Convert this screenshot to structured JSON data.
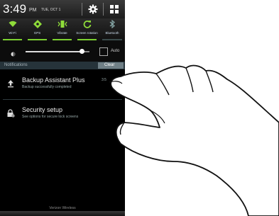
{
  "status_bar": {
    "time": "3:49",
    "ampm": "PM",
    "date": "TUE, OCT 1",
    "settings_icon": "gear-icon",
    "grid_icon": "grid-icon"
  },
  "quick_toggles": [
    {
      "label": "Wi-Fi",
      "icon": "wifi-icon",
      "state": "on"
    },
    {
      "label": "GPS",
      "icon": "gps-icon",
      "state": "on"
    },
    {
      "label": "Vibrate",
      "icon": "vibrate-icon",
      "state": "on"
    },
    {
      "label": "Screen rotation",
      "icon": "rotation-icon",
      "state": "on"
    },
    {
      "label": "Bluetooth",
      "icon": "bluetooth-icon",
      "state": "off"
    }
  ],
  "brightness": {
    "level": 0.88,
    "auto_label": "Auto",
    "auto_checked": false
  },
  "notifications": {
    "header": "Notifications",
    "clear_label": "Clear",
    "items": [
      {
        "title": "Backup Assistant Plus",
        "subtitle": "Backup successfully completed",
        "time": "3:5",
        "icon": "upload-icon"
      },
      {
        "title": "Security setup",
        "subtitle": "See options for secure lock screens",
        "time": "",
        "icon": "lock-settings-icon"
      }
    ]
  },
  "carrier": "Verizon Wireless",
  "colors": {
    "toggle_on": "#8fdc3a",
    "header_bg": "#26333a",
    "clear_bg": "#6f7f86"
  }
}
